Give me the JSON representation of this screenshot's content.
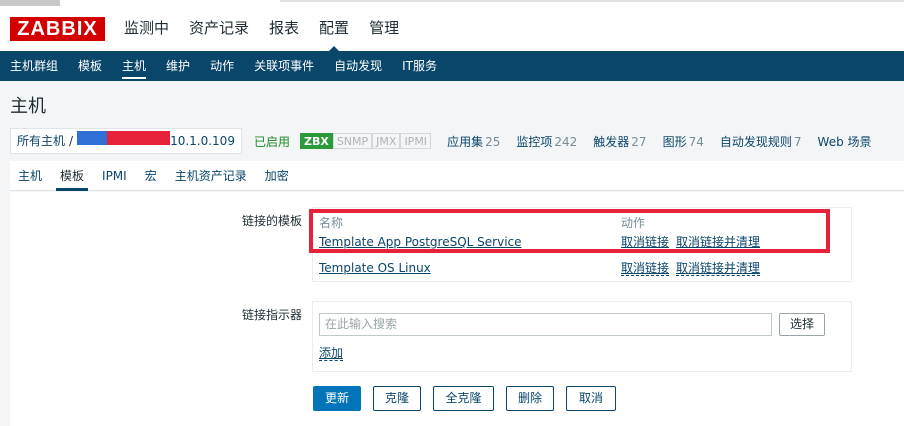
{
  "app": {
    "logo": "ZABBIX"
  },
  "main_menu": [
    {
      "label": "监测中",
      "active": false
    },
    {
      "label": "资产记录",
      "active": false
    },
    {
      "label": "报表",
      "active": false
    },
    {
      "label": "配置",
      "active": true
    },
    {
      "label": "管理",
      "active": false
    }
  ],
  "sub_menu": [
    {
      "label": "主机群组",
      "active": false
    },
    {
      "label": "模板",
      "active": false
    },
    {
      "label": "主机",
      "active": true
    },
    {
      "label": "维护",
      "active": false
    },
    {
      "label": "动作",
      "active": false
    },
    {
      "label": "关联项事件",
      "active": false
    },
    {
      "label": "自动发现",
      "active": false
    },
    {
      "label": "IT服务",
      "active": false
    }
  ],
  "page": {
    "title": "主机"
  },
  "host_nav": {
    "all_hosts": "所有主机",
    "separator": "/",
    "host_suffix": "10.1.0.109",
    "status": "已启用",
    "badges": [
      {
        "label": "ZBX",
        "on": true
      },
      {
        "label": "SNMP",
        "on": false
      },
      {
        "label": "JMX",
        "on": false
      },
      {
        "label": "IPMI",
        "on": false
      }
    ],
    "stats": [
      {
        "label": "应用集",
        "count": "25"
      },
      {
        "label": "监控项",
        "count": "242"
      },
      {
        "label": "触发器",
        "count": "27"
      },
      {
        "label": "图形",
        "count": "74"
      },
      {
        "label": "自动发现规则",
        "count": "7"
      },
      {
        "label": "Web 场景",
        "count": ""
      }
    ]
  },
  "tabs": [
    {
      "label": "主机",
      "active": false
    },
    {
      "label": "模板",
      "active": true
    },
    {
      "label": "IPMI",
      "active": false
    },
    {
      "label": "宏",
      "active": false
    },
    {
      "label": "主机资产记录",
      "active": false
    },
    {
      "label": "加密",
      "active": false
    }
  ],
  "form": {
    "linked_templates_label": "链接的模板",
    "col_name": "名称",
    "col_action": "动作",
    "templates": [
      {
        "name": "Template App PostgreSQL Service",
        "unlink": "取消链接",
        "unlink_clear": "取消链接并清理"
      },
      {
        "name": "Template OS Linux",
        "unlink": "取消链接",
        "unlink_clear": "取消链接并清理"
      }
    ],
    "link_indicator_label": "链接指示器",
    "search_placeholder": "在此输入搜索",
    "select_button": "选择",
    "add_link": "添加",
    "buttons": {
      "update": "更新",
      "clone": "克隆",
      "full_clone": "全克隆",
      "delete": "删除",
      "cancel": "取消"
    }
  },
  "colors": {
    "header_blue": "#0a466a",
    "logo_red": "#d40000",
    "highlight_red": "#e8213a",
    "enabled_green": "#1b8a25",
    "primary_button": "#0275b8"
  }
}
